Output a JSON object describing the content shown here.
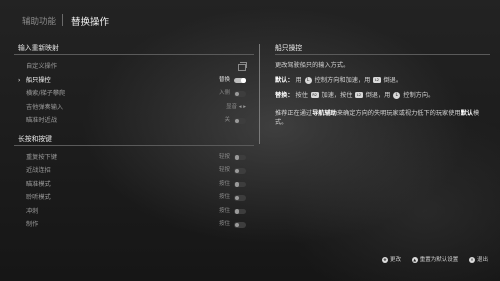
{
  "header": {
    "tab_inactive": "辅助功能",
    "tab_active": "替换操作"
  },
  "sections": [
    {
      "title": "输入重新映射",
      "rows": [
        {
          "label": "自定义操作",
          "value": "",
          "control": "copy-icon"
        },
        {
          "label": "船只操控",
          "value": "替换",
          "control": "toggle-on",
          "selected": true
        },
        {
          "label": "横索/梯子攀爬",
          "value": "入侧",
          "control": "toggle-off"
        },
        {
          "label": "吉他弹奏输入",
          "value": "显音",
          "control": "cycle"
        },
        {
          "label": "瞄准时近战",
          "value": "关",
          "control": "toggle-off"
        }
      ]
    },
    {
      "title": "长按和按键",
      "rows": [
        {
          "label": "重复按下键",
          "value": "轻按",
          "control": "toggle-off"
        },
        {
          "label": "近战连招",
          "value": "轻按",
          "control": "toggle-off"
        },
        {
          "label": "瞄准模式",
          "value": "按住",
          "control": "toggle-off"
        },
        {
          "label": "聆听模式",
          "value": "按住",
          "control": "toggle-off"
        },
        {
          "label": "冲刺",
          "value": "按住",
          "control": "toggle-off"
        },
        {
          "label": "制作",
          "value": "按住",
          "control": "toggle-off"
        }
      ]
    }
  ],
  "description": {
    "title": "船只操控",
    "line1": "更改驾驶船只的输入方式。",
    "default_label": "默认：",
    "default_a": "用",
    "default_b": "控制方向和加速，用",
    "default_c": "倒退。",
    "alt_label": "替换：",
    "alt_a": "按住",
    "alt_b": "加速，按住",
    "alt_c": "倒退，用",
    "alt_d": "控制方向。",
    "note_a": "推荐正在通过",
    "note_b": "导航辅助",
    "note_c": "来确定方向的失明玩家或视力低下的玩家使用",
    "note_d": "默认",
    "note_e": "模式。",
    "glyph_ls": "L",
    "glyph_l2": "L2",
    "glyph_r2": "R2"
  },
  "footer": [
    {
      "glyph": "✥",
      "label": "更改"
    },
    {
      "glyph": "▲",
      "label": "重置为默认设置"
    },
    {
      "glyph": "✕",
      "label": "退出"
    }
  ]
}
